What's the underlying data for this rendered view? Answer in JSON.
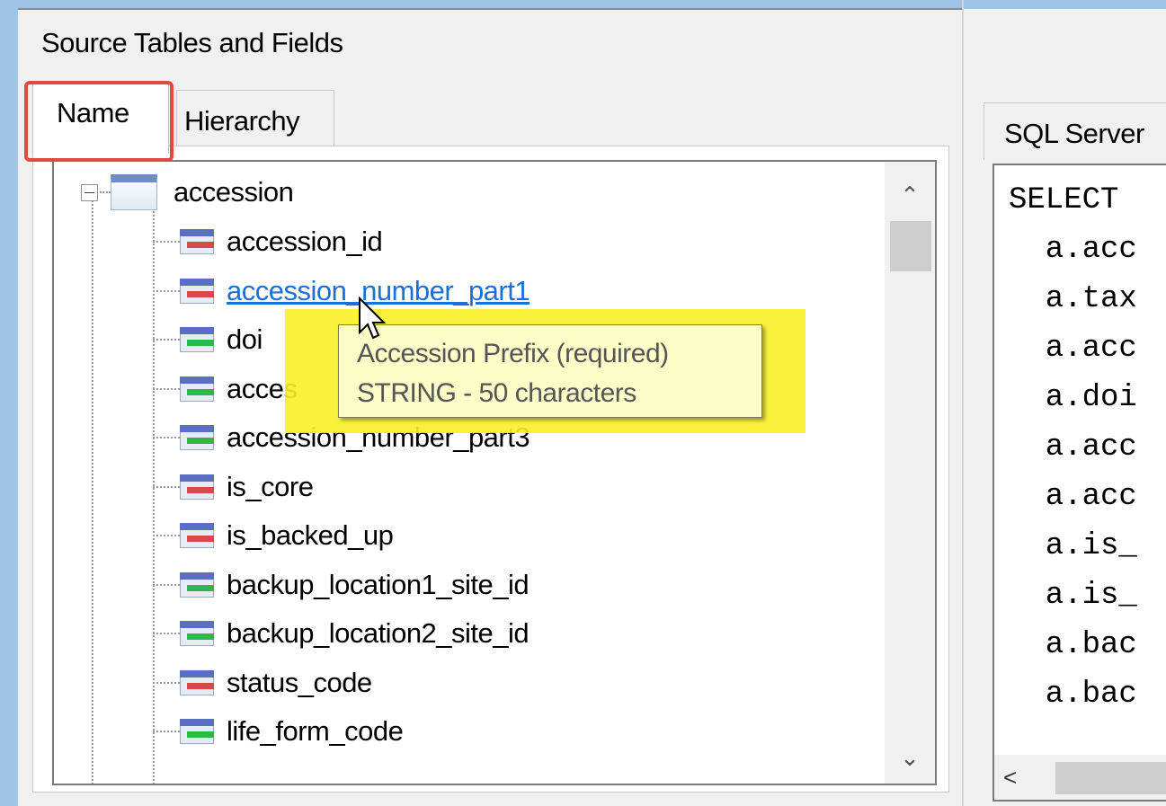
{
  "left_panel": {
    "title": "Source Tables and Fields",
    "tabs": [
      {
        "label": "Name",
        "active": true
      },
      {
        "label": "Hierarchy",
        "active": false
      }
    ],
    "tree": {
      "root_label": "accession",
      "fields": [
        {
          "label": "accession_id",
          "icon": "key-field-icon",
          "hovered": false
        },
        {
          "label": "accession_number_part1",
          "icon": "key-field-icon",
          "hovered": true
        },
        {
          "label": "doi",
          "icon": "foreign-field-icon",
          "hovered": false
        },
        {
          "label": "acces",
          "icon": "foreign-field-icon",
          "hovered": false
        },
        {
          "label": "accession_number_part3",
          "icon": "foreign-field-icon",
          "hovered": false
        },
        {
          "label": "is_core",
          "icon": "key-field-icon",
          "hovered": false
        },
        {
          "label": "is_backed_up",
          "icon": "key-field-icon",
          "hovered": false
        },
        {
          "label": "backup_location1_site_id",
          "icon": "foreign-field-icon",
          "hovered": false
        },
        {
          "label": "backup_location2_site_id",
          "icon": "foreign-field-icon",
          "hovered": false
        },
        {
          "label": "status_code",
          "icon": "key-field-icon",
          "hovered": false
        },
        {
          "label": "life_form_code",
          "icon": "foreign-field-icon",
          "hovered": false
        }
      ]
    },
    "tooltip": {
      "line1": "Accession Prefix (required)",
      "line2": "STRING - 50 characters"
    },
    "scroll_up": "^",
    "scroll_down": "v"
  },
  "right_panel": {
    "tab_label": "SQL Server",
    "sql_lines": [
      "SELECT",
      "  a.acc",
      "  a.tax",
      "  a.acc",
      "  a.doi",
      "  a.acc",
      "  a.acc",
      "  a.is_",
      "  a.is_",
      "  a.bac",
      "  a.bac"
    ],
    "hscroll_left": "<"
  },
  "colors": {
    "tab_highlight": "#e04848",
    "tooltip_highlight": "#faf028",
    "link": "#1c6fd6",
    "key_bar": "#d44a4a",
    "fk_bar": "#2fb84a"
  }
}
